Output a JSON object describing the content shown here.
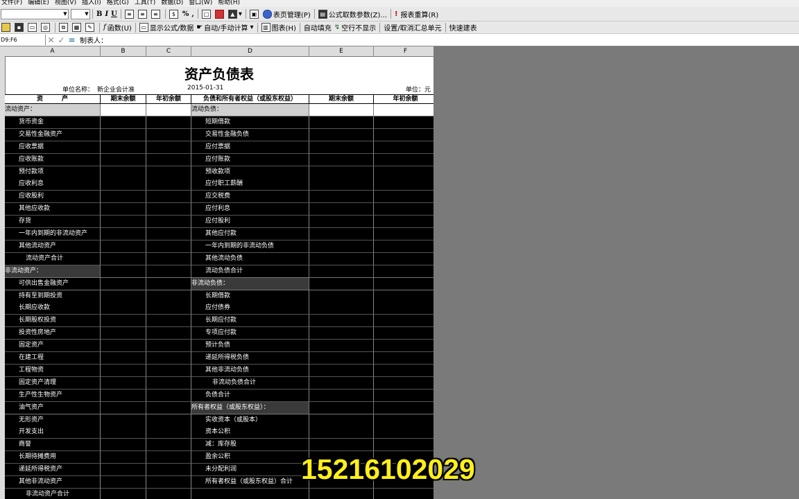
{
  "menu": [
    "文件(F)",
    "编辑(E)",
    "视图(V)",
    "插入(I)",
    "格式(G)",
    "工具(T)",
    "数据(D)",
    "窗口(W)",
    "帮助(H)"
  ],
  "toolbar1": {
    "bold": "B",
    "italic": "I",
    "underline": "U",
    "percent": "%",
    "comma": ",",
    "sheet_manage": "表页管理(P)",
    "formula_fetch": "公式取数参数(Z)...",
    "recalc": "报表重算(R)"
  },
  "toolbar2": {
    "func": "函数(U)",
    "show_formula": "显示公式/数据",
    "auto_calc": "自动/手动计算",
    "chart": "图表(H)",
    "auto_fill": "自动填充",
    "hide_empty": "空行不显示",
    "set_summary": "设置/取消汇总单元",
    "quick_build": "快速建表"
  },
  "formula_bar": {
    "cell_ref": "D9:F6",
    "content": "制表人："
  },
  "columns": [
    "A",
    "B",
    "C",
    "D",
    "E",
    "F"
  ],
  "sheet": {
    "title": "资产负债表",
    "unit_name_label": "单位名称：",
    "unit_name": "新企业会计准",
    "date": "2015-01-31",
    "unit_label": "单位：元",
    "headers": [
      "资　　　产",
      "期末余额",
      "年初余额",
      "负债和所有者权益（或股东权益）",
      "期末余额",
      "年初余额"
    ],
    "rows": [
      {
        "left": "流动资产：",
        "right": "流动负债：",
        "type": "section"
      },
      {
        "left": "货币资金",
        "right": "短期借款"
      },
      {
        "left": "交易性金融资产",
        "right": "交易性金融负债"
      },
      {
        "left": "应收票据",
        "right": "应付票据"
      },
      {
        "left": "应收账款",
        "right": "应付账款"
      },
      {
        "left": "预付款项",
        "right": "预收款项"
      },
      {
        "left": "应收利息",
        "right": "应付职工薪酬"
      },
      {
        "left": "应收股利",
        "right": "应交税费"
      },
      {
        "left": "其他应收款",
        "right": "应付利息"
      },
      {
        "left": "存货",
        "right": "应付股利"
      },
      {
        "left": "一年内到期的非流动资产",
        "right": "其他应付款"
      },
      {
        "left": "其他流动资产",
        "right": "一年内到期的非流动负债"
      },
      {
        "left": "流动资产合计",
        "right": "其他流动负债",
        "left_indent": 2
      },
      {
        "left": "非流动资产：",
        "right": "流动负债合计",
        "type": "left-section"
      },
      {
        "left": "可供出售金融资产",
        "right": "非流动负债：",
        "type": "right-section"
      },
      {
        "left": "持有至到期投资",
        "right": "长期借款"
      },
      {
        "left": "长期应收款",
        "right": "应付债券"
      },
      {
        "left": "长期股权投资",
        "right": "长期应付款"
      },
      {
        "left": "投资性房地产",
        "right": "专项应付款"
      },
      {
        "left": "固定资产",
        "right": "预计负债"
      },
      {
        "left": "在建工程",
        "right": "递延所得税负债"
      },
      {
        "left": "工程物资",
        "right": "其他非流动负债"
      },
      {
        "left": "固定资产清理",
        "right": "非流动负债合计",
        "right_indent": 2
      },
      {
        "left": "生产性生物资产",
        "right": "负债合计"
      },
      {
        "left": "油气资产",
        "right": "所有者权益（或股东权益）：",
        "type": "right-section"
      },
      {
        "left": "无形资产",
        "right": "实收资本（或股本）"
      },
      {
        "left": "开发支出",
        "right": "资本公积"
      },
      {
        "left": "商誉",
        "right": "减：库存股"
      },
      {
        "left": "长期待摊费用",
        "right": "盈余公积"
      },
      {
        "left": "递延所得税资产",
        "right": "未分配利润"
      },
      {
        "left": "其他非流动资产",
        "right": "所有者权益（或股东权益）合计"
      },
      {
        "left": "非流动资产合计",
        "right": "",
        "left_indent": 2
      }
    ]
  },
  "overlay_number": "15216102029"
}
